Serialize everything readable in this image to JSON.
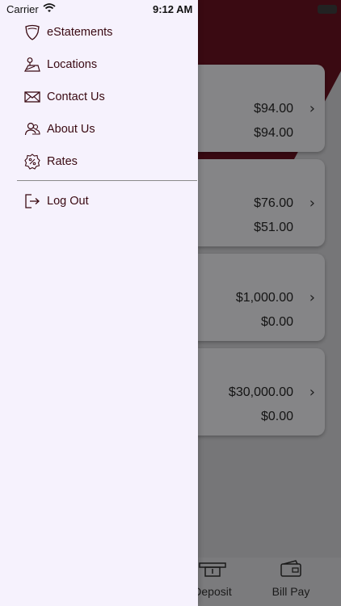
{
  "status_bar": {
    "carrier": "Carrier",
    "time": "9:12 AM"
  },
  "menu": {
    "items": [
      {
        "label": "eStatements",
        "icon": "shield-icon"
      },
      {
        "label": "Locations",
        "icon": "map-pin-icon"
      },
      {
        "label": "Contact Us",
        "icon": "envelope-icon"
      },
      {
        "label": "About Us",
        "icon": "people-icon"
      },
      {
        "label": "Rates",
        "icon": "percent-badge-icon"
      }
    ],
    "logout": {
      "label": "Log Out",
      "icon": "logout-icon"
    }
  },
  "accounts": [
    {
      "balance": "$94.00",
      "available": "$94.00"
    },
    {
      "balance": "$76.00",
      "available": "$51.00"
    },
    {
      "balance": "$1,000.00",
      "available": "$0.00"
    },
    {
      "balance": "$30,000.00",
      "available": "$0.00"
    }
  ],
  "tabbar": {
    "deposit": "Deposit",
    "bill_pay": "Bill Pay"
  },
  "colors": {
    "accent": "#3a0a12",
    "drawer_bg": "#f6f2fd"
  }
}
